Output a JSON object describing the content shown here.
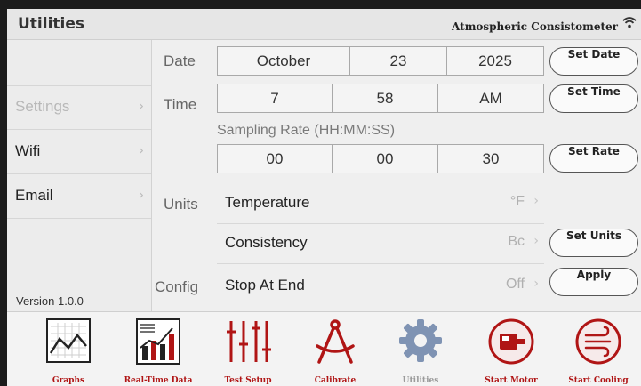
{
  "header": {
    "title": "Utilities",
    "device": "Atmospheric Consistometer"
  },
  "sidebar": {
    "items": [
      {
        "label": "Settings",
        "state": "disabled"
      },
      {
        "label": "Wifi"
      },
      {
        "label": "Email"
      }
    ],
    "version": "Version 1.0.0"
  },
  "date": {
    "label": "Date",
    "month": "October",
    "day": "23",
    "year": "2025",
    "button": "Set Date"
  },
  "time": {
    "label": "Time",
    "hour": "7",
    "minute": "58",
    "ampm": "AM",
    "button": "Set Time"
  },
  "sampling": {
    "title": "Sampling Rate (HH:MM:SS)",
    "hh": "00",
    "mm": "00",
    "ss": "30",
    "button": "Set Rate"
  },
  "units": {
    "label": "Units",
    "temperature": {
      "name": "Temperature",
      "value": "°F"
    },
    "consistency": {
      "name": "Consistency",
      "value": "Bc"
    },
    "button": "Set Units"
  },
  "config": {
    "label": "Config",
    "stop": {
      "name": "Stop At End",
      "value": "Off"
    },
    "button": "Apply"
  },
  "toolbar": [
    {
      "label": "Graphs",
      "icon": "graphs-icon"
    },
    {
      "label": "Real-Time Data",
      "icon": "realtime-data-icon"
    },
    {
      "label": "Test Setup",
      "icon": "sliders-icon"
    },
    {
      "label": "Calibrate",
      "icon": "compass-icon"
    },
    {
      "label": "Utilities",
      "icon": "gear-icon",
      "state": "current"
    },
    {
      "label": "Start Motor",
      "icon": "motor-icon"
    },
    {
      "label": "Start Cooling",
      "icon": "cooling-icon"
    }
  ],
  "colors": {
    "accent": "#b01515",
    "background": "#efefef"
  }
}
